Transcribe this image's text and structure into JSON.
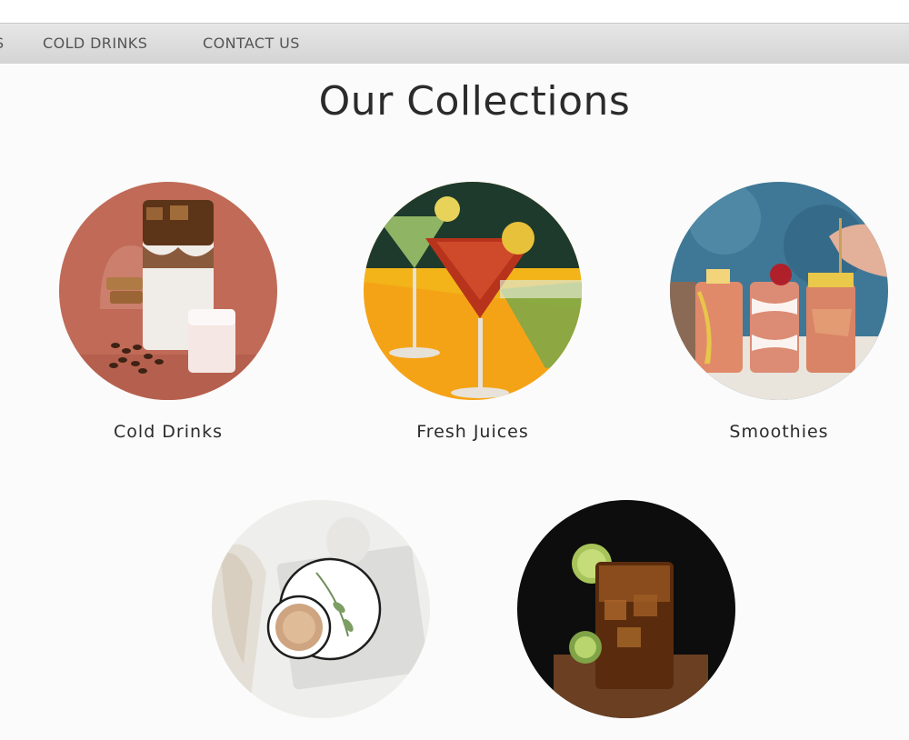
{
  "nav": {
    "clipped_label": "S",
    "items": [
      "COLD DRINKS",
      "CONTACT US"
    ]
  },
  "section": {
    "title": "Our Collections"
  },
  "collections": [
    {
      "label": "Cold Drinks",
      "image": "iced-coffee-image"
    },
    {
      "label": "Fresh Juices",
      "image": "cocktail-glasses-image"
    },
    {
      "label": "Smoothies",
      "image": "smoothie-glasses-image"
    },
    {
      "label": "",
      "image": "latte-cup-image"
    },
    {
      "label": "",
      "image": "iced-tea-image"
    }
  ],
  "colors": {
    "nav_bg": "#d9d9d9",
    "page_bg": "#fbfbfb",
    "text": "#2b2b2b"
  }
}
